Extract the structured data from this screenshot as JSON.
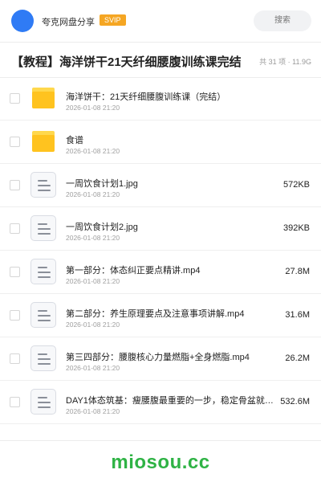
{
  "header": {
    "site_name": "夸克网盘分享",
    "badge": "SVIP",
    "search_placeholder": "搜索",
    "brand_color": "#2f7bf5",
    "badge_color": "#f5a623"
  },
  "share": {
    "title": "【教程】海洋饼干21天纤细腰腹训练课完结",
    "meta": "共 31 项 · 11.9G"
  },
  "items": [
    {
      "type": "folder",
      "name": "海洋饼干：21天纤细腰腹训练课（完结）",
      "date": "2026-01-08 21:20",
      "size": ""
    },
    {
      "type": "folder",
      "name": "食谱",
      "date": "2026-01-08 21:20",
      "size": ""
    },
    {
      "type": "file",
      "name": "一周饮食计划1.jpg",
      "date": "2026-01-08 21:20",
      "size": "572KB"
    },
    {
      "type": "file",
      "name": "一周饮食计划2.jpg",
      "date": "2026-01-08 21:20",
      "size": "392KB"
    },
    {
      "type": "file",
      "name": "第一部分：体态纠正要点精讲.mp4",
      "date": "2026-01-08 21:20",
      "size": "27.8M"
    },
    {
      "type": "file",
      "name": "第二部分：养生原理要点及注意事项讲解.mp4",
      "date": "2026-01-08 21:20",
      "size": "31.6M"
    },
    {
      "type": "file",
      "name": "第三四部分：腰腹核心力量燃脂+全身燃脂.mp4",
      "date": "2026-01-08 21:20",
      "size": "26.2M"
    },
    {
      "type": "file",
      "name": "DAY1体态筑基：瘦腰腹最重要的一步，稳定骨盆就是…",
      "date": "2026-01-08 21:20",
      "size": "532.6M"
    }
  ],
  "watermark": {
    "text": "miosou.cc",
    "color": "#2fb345"
  }
}
